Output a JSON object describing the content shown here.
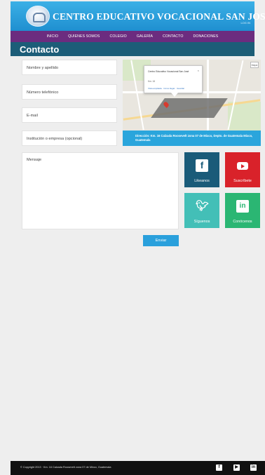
{
  "header": {
    "site_title": "CENTRO EDUCATIVO VOCACIONAL SAN JOSÉ",
    "login_label": "LOG IN",
    "brand_color": "#2a9fdc"
  },
  "nav": {
    "items": [
      {
        "label": "INICIO"
      },
      {
        "label": "QUIENES SOMOS"
      },
      {
        "label": "COLEGIO"
      },
      {
        "label": "GALERÍA"
      },
      {
        "label": "CONTACTO"
      },
      {
        "label": "DONACIONES"
      }
    ],
    "background": "#6c2c7f"
  },
  "page": {
    "title": "Contacto"
  },
  "form": {
    "name_placeholder": "Nombre y apellido",
    "phone_placeholder": "Número telefónico",
    "email_placeholder": "E-mail",
    "institution_placeholder": "Institución o empresa (opcional)",
    "message_placeholder": "Mensaje",
    "submit_label": "Enviar"
  },
  "map": {
    "popup_title": "Centro Educativo Vocacional San José",
    "popup_line": "Km. 16",
    "popup_links": "Vista ampliada · Cómo llegar · Guardar",
    "zoom_label": "Mapa"
  },
  "address": {
    "text": "Dirección: Km. 16 Calzada Roosevelt zona 07 de Mixco, Depto. de Guatemala Mixco, Guatemala"
  },
  "social": {
    "facebook": {
      "label": "Likeanos",
      "icon": "facebook-icon",
      "color": "#1a5b79"
    },
    "youtube": {
      "label": "Suscríbete",
      "icon": "youtube-icon",
      "color": "#d9222a"
    },
    "twitter": {
      "label": "Síguenos",
      "icon": "twitter-icon",
      "color": "#43bfb7"
    },
    "linkedin": {
      "label": "Conócenos",
      "icon": "linkedin-icon",
      "color": "#2bb673"
    }
  },
  "footer": {
    "copyright": "© Copyright 2013  ·  Km. 16 Calzada Roosevelt zona 07 de Mixco, Guatemala"
  }
}
